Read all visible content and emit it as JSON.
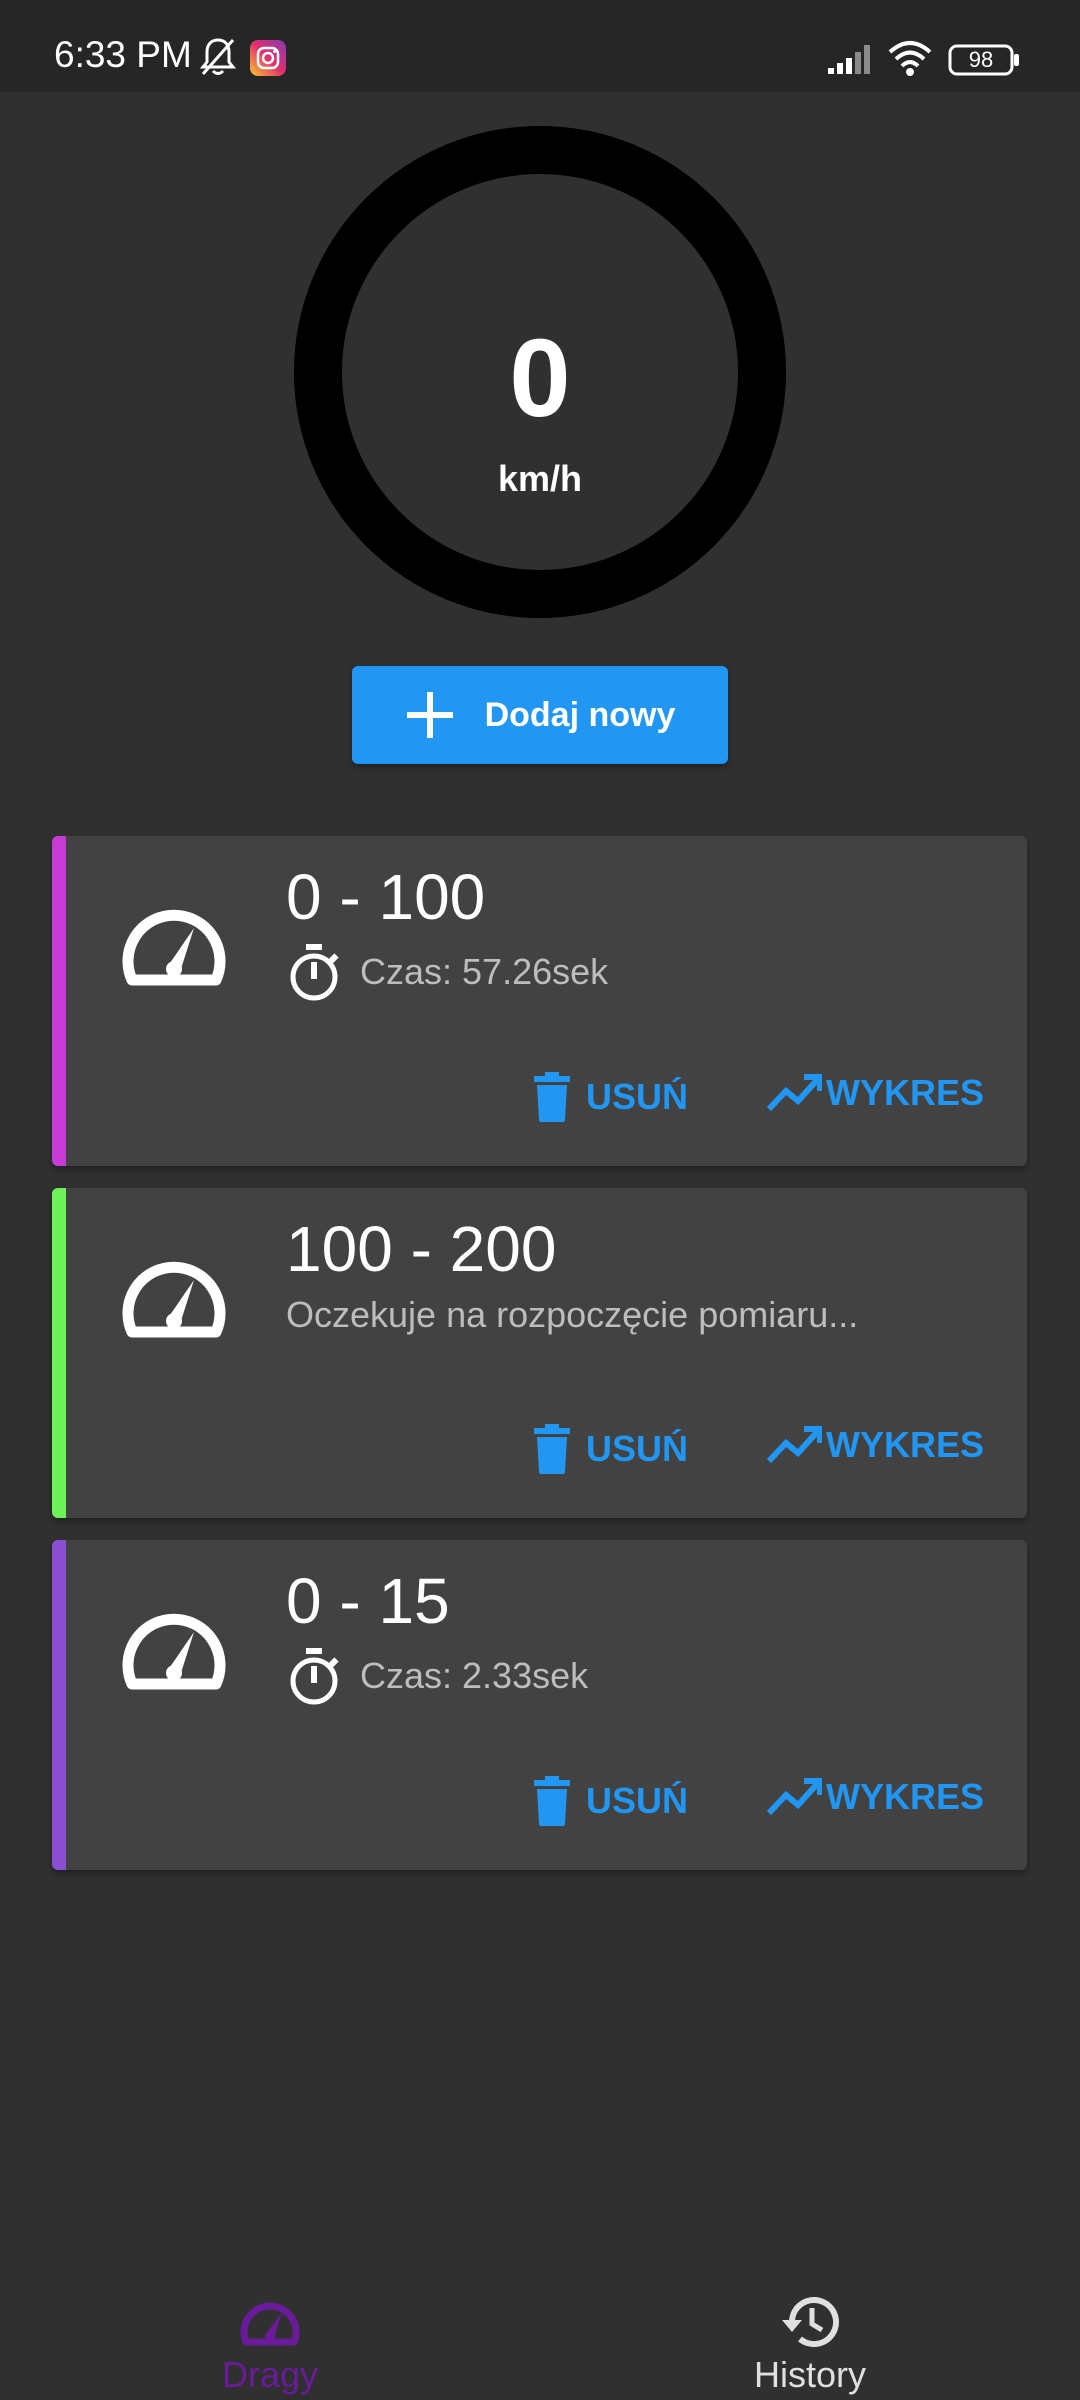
{
  "status_bar": {
    "time": "6:33 PM",
    "battery": "98",
    "icons": [
      "bell-off-icon",
      "instagram-icon",
      "signal-icon",
      "wifi-icon",
      "battery-icon"
    ]
  },
  "speedometer": {
    "value": "0",
    "unit": "km/h"
  },
  "add_button": {
    "label": "Dodaj nowy",
    "icon": "plus-icon",
    "color": "#2196F3"
  },
  "cards": [
    {
      "title": "0 - 100",
      "subtitle": "Czas: 57.26sek",
      "has_timer": true,
      "stripe_color": "#C63BD6",
      "delete_label": "USUŃ",
      "chart_label": "WYKRES"
    },
    {
      "title": "100 - 200",
      "subtitle": "Oczekuje na rozpoczęcie pomiaru...",
      "has_timer": false,
      "stripe_color": "#6EF25A",
      "delete_label": "USUŃ",
      "chart_label": "WYKRES"
    },
    {
      "title": "0 - 15",
      "subtitle": "Czas: 2.33sek",
      "has_timer": true,
      "stripe_color": "#8A4FD0",
      "delete_label": "USUŃ",
      "chart_label": "WYKRES"
    }
  ],
  "bottom_nav": {
    "items": [
      {
        "label": "Dragy",
        "icon": "speedometer-icon",
        "active": true,
        "color": "#6A1B9A"
      },
      {
        "label": "History",
        "icon": "history-icon",
        "active": false,
        "color": "#E0E0E0"
      }
    ]
  },
  "colors": {
    "background": "#303030",
    "card": "#424242",
    "accent": "#2196F3"
  }
}
